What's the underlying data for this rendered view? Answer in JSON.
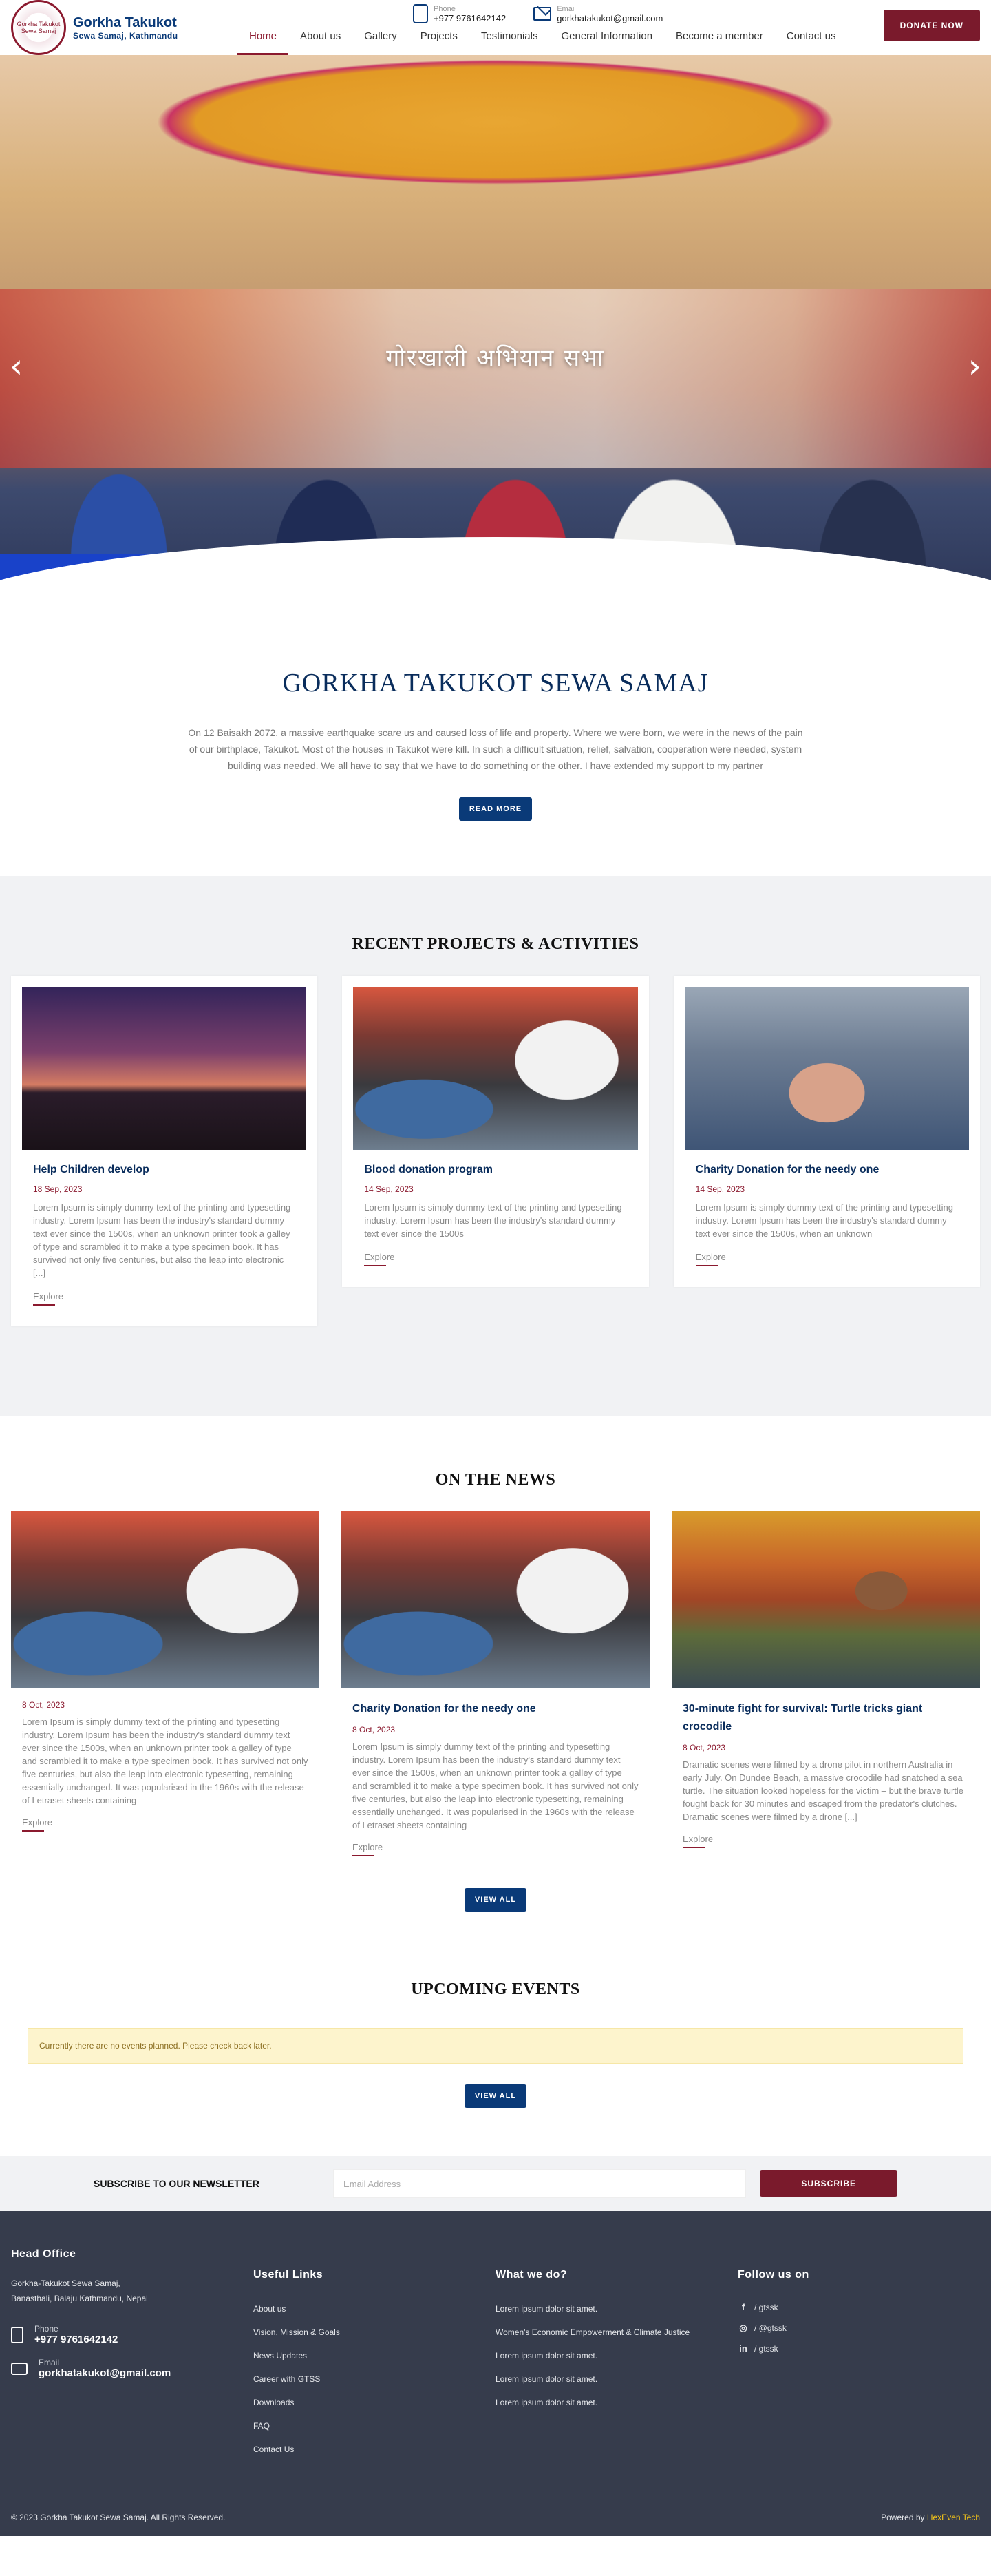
{
  "header": {
    "logo_text": "Gorkha Takukot Sewa Samaj",
    "brand_title": "Gorkha Takukot",
    "brand_sub": "Sewa Samaj, Kathmandu",
    "phone_label": "Phone",
    "phone_value": "+977 9761642142",
    "email_label": "Email",
    "email_value": "gorkhatakukot@gmail.com",
    "donate_label": "DONATE NOW",
    "nav": [
      "Home",
      "About us",
      "Gallery",
      "Projects",
      "Testimonials",
      "General Information",
      "Become a member",
      "Contact us"
    ],
    "active_nav": "Home"
  },
  "hero": {
    "title": "गोरखाली अभियान सभा",
    "prev_arrow": "‹",
    "next_arrow": "›"
  },
  "intro": {
    "title": "GORKHA TAKUKOT SEWA SAMAJ",
    "text": "On 12 Baisakh 2072, a massive earthquake scare us and caused loss of life and property. Where we were born, we were in the news of the pain of our birthplace, Takukot. Most of the houses in Takukot were kill. In such a difficult situation, relief, salvation, cooperation were needed, system building was needed. We all have to say that we have to do something or the other. I have extended my support to my partner",
    "button": "READ MORE"
  },
  "projects": {
    "title": "RECENT PROJECTS & ACTIVITIES",
    "items": [
      {
        "title": "Help Children develop",
        "date": "18 Sep, 2023",
        "text": "Lorem Ipsum is simply dummy text of the printing and typesetting industry. Lorem Ipsum has been the industry's standard dummy text ever since the 1500s, when an unknown printer took a galley of type and scrambled it to make a type specimen book. It has survived not only five centuries, but also the leap into electronic [...]",
        "link": "Explore"
      },
      {
        "title": "Blood donation program",
        "date": "14 Sep, 2023",
        "text": "Lorem Ipsum is simply dummy text of the printing and typesetting industry. Lorem Ipsum has been the industry's standard dummy text ever since the 1500s",
        "link": "Explore"
      },
      {
        "title": "Charity Donation for the needy one",
        "date": "14 Sep, 2023",
        "text": "Lorem Ipsum is simply dummy text of the printing and typesetting industry. Lorem Ipsum has been the industry's standard dummy text ever since the 1500s, when an unknown",
        "link": "Explore"
      }
    ]
  },
  "news": {
    "title": "ON THE NEWS",
    "items": [
      {
        "title": "",
        "date": "8 Oct, 2023",
        "text": "Lorem Ipsum is simply dummy text of the printing and typesetting industry. Lorem Ipsum has been the industry's standard dummy text ever since the 1500s, when an unknown printer took a galley of type and scrambled it to make a type specimen book. It has survived not only five centuries, but also the leap into electronic typesetting, remaining essentially unchanged. It was popularised in the 1960s with the release of Letraset sheets containing",
        "link": "Explore"
      },
      {
        "title": "Charity Donation for the needy one",
        "date": "8 Oct, 2023",
        "text": "Lorem Ipsum is simply dummy text of the printing and typesetting industry. Lorem Ipsum has been the industry's standard dummy text ever since the 1500s, when an unknown printer took a galley of type and scrambled it to make a type specimen book. It has survived not only five centuries, but also the leap into electronic typesetting, remaining essentially unchanged. It was popularised in the 1960s with the release of Letraset sheets containing",
        "link": "Explore"
      },
      {
        "title": "30-minute fight for survival: Turtle tricks giant crocodile",
        "date": "8 Oct, 2023",
        "text": "Dramatic scenes were filmed by a drone pilot in northern Australia in early July. On Dundee Beach, a massive crocodile had snatched a sea turtle. The situation looked hopeless for the victim – but the brave turtle fought back for 30 minutes and escaped from the predator's clutches. Dramatic scenes were filmed by a drone [...]",
        "link": "Explore"
      }
    ],
    "button": "VIEW ALL"
  },
  "events": {
    "title": "UPCOMING EVENTS",
    "alert": "Currently there are no events planned. Please check back later.",
    "button": "VIEW ALL"
  },
  "newsletter": {
    "label": "SUBSCRIBE TO OUR NEWSLETTER",
    "placeholder": "Email Address",
    "button": "SUBSCRIBE"
  },
  "footer": {
    "head_office_title": "Head Office",
    "address_line1": "Gorkha-Takukot Sewa Samaj,",
    "address_line2": "Banasthali, Balaju Kathmandu, Nepal",
    "phone_label": "Phone",
    "phone_value": "+977 9761642142",
    "email_label": "Email",
    "email_value": "gorkhatakukot@gmail.com",
    "links_title": "Useful Links",
    "links": [
      "About us",
      "Vision, Mission & Goals",
      "News Updates",
      "Career with GTSS",
      "Downloads",
      "FAQ",
      "Contact Us"
    ],
    "whatwedo_title": "What we do?",
    "whatwedo": [
      "Lorem ipsum dolor sit amet.",
      "Women's Economic Empowerment & Climate Justice",
      "Lorem ipsum dolor sit amet.",
      "Lorem ipsum dolor sit amet.",
      "Lorem ipsum dolor sit amet."
    ],
    "follow_title": "Follow us on",
    "social": [
      {
        "icon": "facebook-icon",
        "glyph": "f",
        "text": "/ gtssk"
      },
      {
        "icon": "instagram-icon",
        "glyph": "◎",
        "text": "/ @gtssk"
      },
      {
        "icon": "linkedin-icon",
        "glyph": "in",
        "text": "/ gtssk"
      }
    ],
    "copyright": "© 2023 Gorkha Takukot Sewa Samaj. All Rights Reserved.",
    "powered_prefix": "Powered by",
    "powered_brand": "HexEven Tech"
  },
  "colors": {
    "primary": "#0a3a78",
    "accent": "#7a1a2c",
    "footer_bg": "#363c4c",
    "alert_bg": "#fdf4cd"
  }
}
